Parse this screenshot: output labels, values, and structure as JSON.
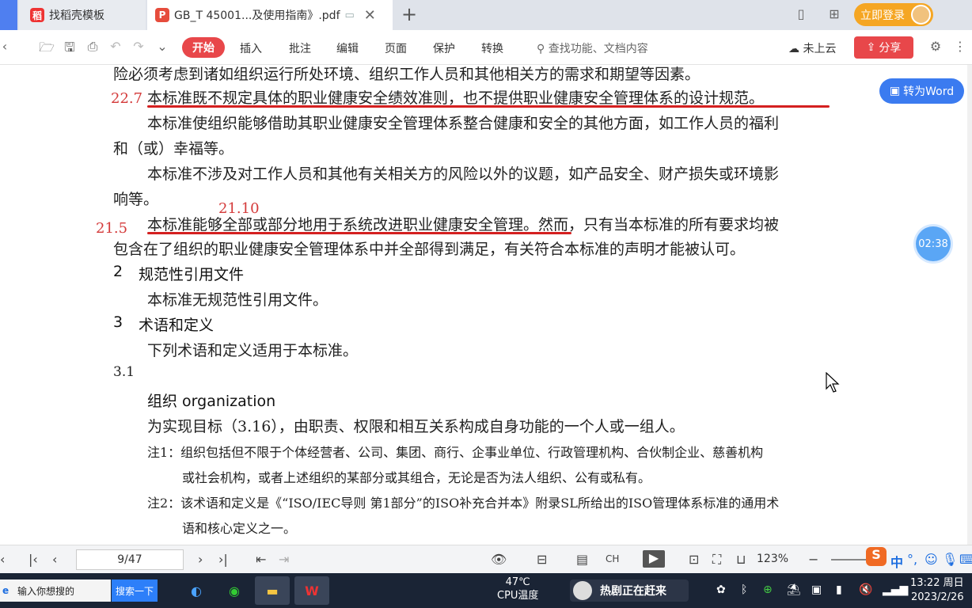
{
  "tabs": [
    {
      "logo": "稻",
      "label": "找稻壳模板"
    },
    {
      "logo": "P",
      "label": "GB_T 45001...及使用指南》.pdf"
    }
  ],
  "header": {
    "login_label": "立即登录",
    "add_tab_icon": "plus-icon"
  },
  "toolbar": {
    "menus": [
      "开始",
      "插入",
      "批注",
      "编辑",
      "页面",
      "保护",
      "转换"
    ],
    "search_placeholder": "查找功能、文档内容",
    "cloud_status": "未上云",
    "share_label": "分享"
  },
  "document": {
    "lines": [
      "险必须考虑到诸如组织运行所处环境、组织工作人员和其他相关方的需求和期望等因素。",
      "本标准既不规定具体的职业健康安全绩效准则，也不提供职业健康安全管理体系的设计规范。",
      "本标准使组织能够借助其职业健康安全管理体系整合健康和安全的其他方面，如工作人员的福利",
      "和（或）幸福等。",
      "本标准不涉及对工作人员和其他有关相关方的风险以外的议题，如产品安全、财产损失或环境影",
      "响等。",
      "本标准能够全部或部分地用于系统改进职业健康安全管理。然而，只有当本标准的所有要求均被",
      "包含在了组织的职业健康安全管理体系中并全部得到满足，有关符合本标准的声明才能被认可。"
    ],
    "section2_num": "2",
    "section2_title": "规范性引用文件",
    "section2_body": "本标准无规范性引用文件。",
    "section3_num": "3",
    "section3_title": "术语和定义",
    "section3_body": "下列术语和定义适用于本标准。",
    "term_num": "3.1",
    "term_title": "组织  organization",
    "term_def": "为实现目标（3.16），由职责、权限和相互关系构成自身功能的一个人或一组人。",
    "note1_a": "注1：组织包括但不限于个体经营者、公司、集团、商行、企事业单位、行政管理机构、合伙制企业、慈善机构",
    "note1_b": "或社会机构，或者上述组织的某部分或其组合，无论是否为法人组织、公有或私有。",
    "note2_a": "注2：该术语和定义是《“ISO/IEC导则 第1部分”的ISO补充合并本》附录SL所给出的ISO管理体系标准的通用术",
    "note2_b": "语和核心定义之一。",
    "annotations": [
      "22.7",
      "21.10",
      "21.5"
    ],
    "convert_label": "转为Word",
    "timer": "02:38"
  },
  "statusbar": {
    "page": "9/47",
    "input_lang": "CH",
    "zoom": "123%",
    "ime": "中"
  },
  "taskbar": {
    "search_placeholder": "输入你想搜的",
    "search_button": "搜索一下",
    "cpu_temp": "47℃",
    "cpu_label": "CPU温度",
    "news": "热剧正在赶来",
    "time": "13:22 周日",
    "date": "2023/2/26"
  },
  "colors": {
    "accent_red": "#e8474a",
    "annotation_red": "#d43a3a",
    "brand_blue": "#3b7bf0",
    "login_orange": "#f5a623"
  }
}
